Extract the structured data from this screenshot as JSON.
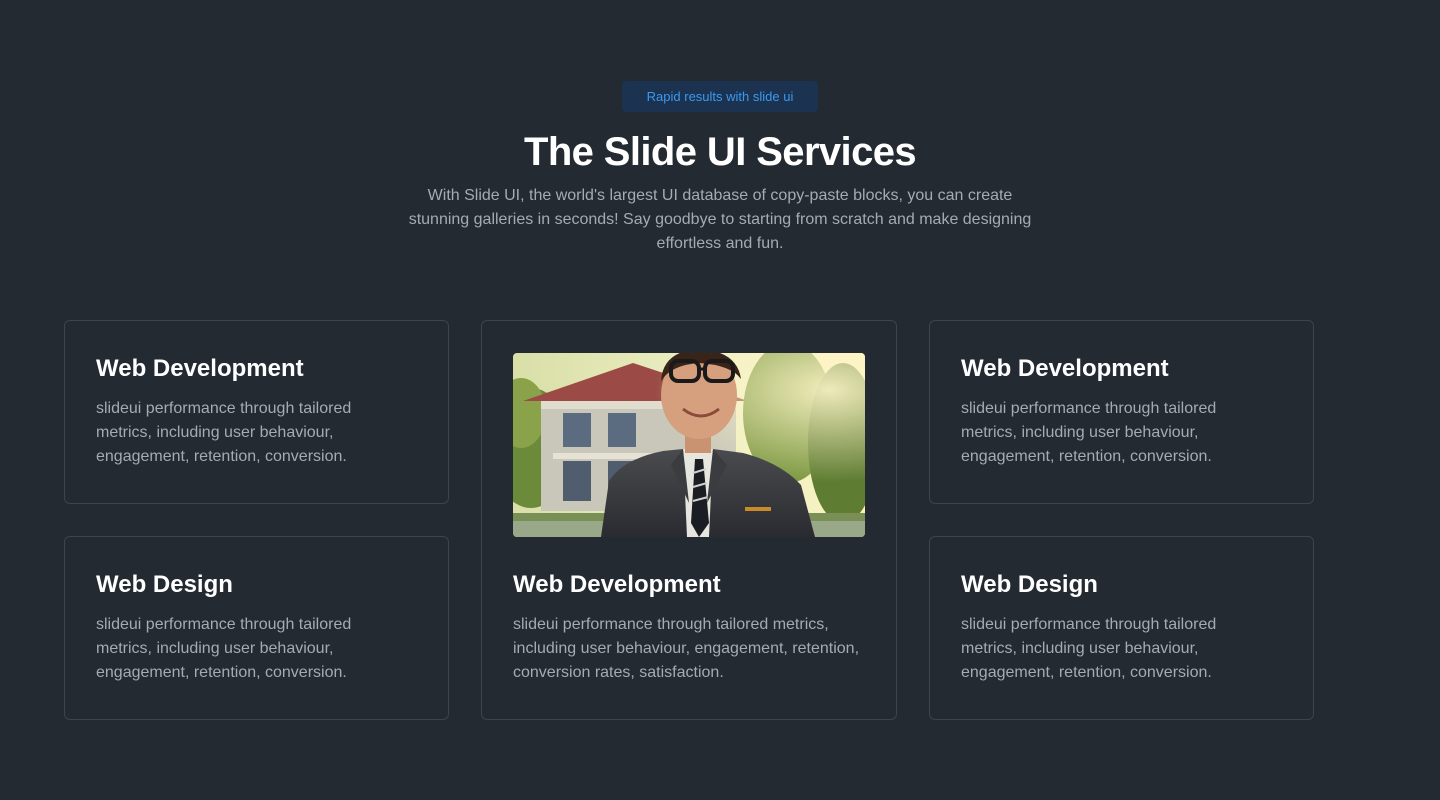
{
  "header": {
    "badge": "Rapid results with slide ui",
    "title": "The Slide UI Services",
    "description": "With Slide UI, the world's largest UI database of copy-paste blocks, you can create stunning galleries in seconds! Say goodbye to starting from scratch and make designing effortless and fun."
  },
  "cards": [
    {
      "title": "Web Development",
      "text": "slideui performance through tailored metrics, including user behaviour, engagement, retention, conversion."
    },
    {
      "title": "Web Development",
      "text": "slideui performance through tailored metrics, including user behaviour, engagement, retention, conversion rates, satisfaction.",
      "image": "portrait-man-in-suit-photo"
    },
    {
      "title": "Web Development",
      "text": "slideui performance through tailored metrics, including user behaviour, engagement, retention, conversion."
    },
    {
      "title": "Web Design",
      "text": "slideui performance through tailored metrics, including user behaviour, engagement, retention, conversion."
    },
    {
      "title": "Web Design",
      "text": "slideui performance through tailored metrics, including user behaviour, engagement, retention, conversion."
    }
  ],
  "colors": {
    "background": "#232a31",
    "badge_bg": "#1b3350",
    "badge_text": "#3d98ef",
    "card_border": "#3d444d",
    "heading": "#ffffff",
    "body_text": "#a4abb5"
  }
}
